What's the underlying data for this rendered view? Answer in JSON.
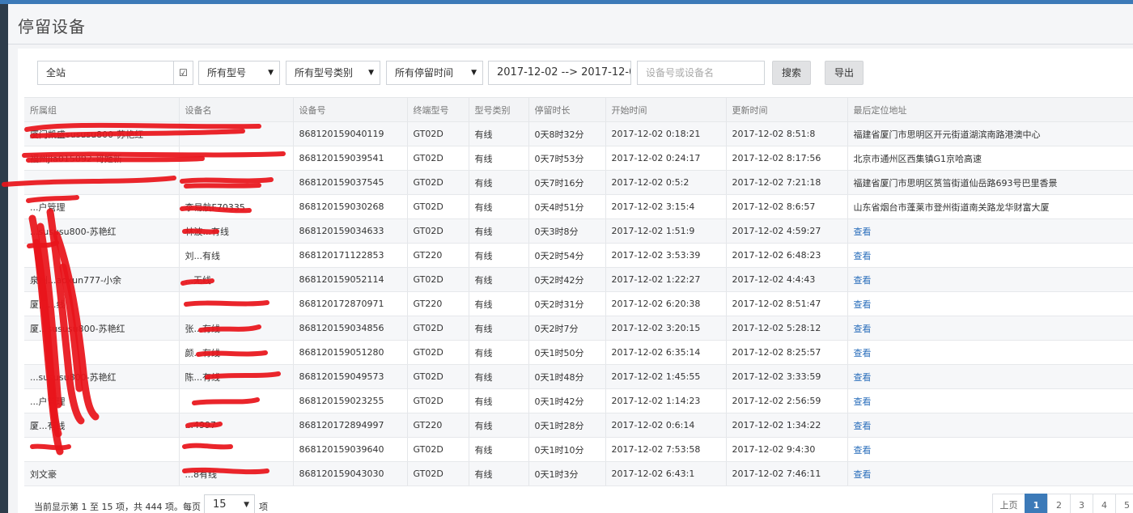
{
  "page": {
    "title": "停留设备"
  },
  "filters": {
    "scope": "全站",
    "model": "所有型号",
    "model_type": "所有型号类别",
    "stay_time": "所有停留时间",
    "date_range": "2017-12-02 --> 2017-12-0",
    "search_placeholder": "设备号或设备名",
    "search_label": "搜索",
    "export_label": "导出"
  },
  "table": {
    "columns": [
      "所属组",
      "设备名",
      "设备号",
      "终端型号",
      "型号类别",
      "停留时长",
      "开始时间",
      "更新时间",
      "最后定位地址"
    ],
    "rows": [
      [
        "厦门凯盛sususu800-苏艳红",
        "",
        "868120159040119",
        "GT02D",
        "有线",
        "0天8时32分",
        "2017-12-02 0:18:21",
        "2017-12-02 8:51:8",
        "福建省厦门市思明区开元街道湖滨南路港澳中心"
      ],
      [
        "福州jia015092-哥姬新",
        "",
        "868120159039541",
        "GT02D",
        "有线",
        "0天7时53分",
        "2017-12-02 0:24:17",
        "2017-12-02 8:17:56",
        "北京市通州区西集镇G1京哈高速"
      ],
      [
        "",
        "",
        "868120159037545",
        "GT02D",
        "有线",
        "0天7时16分",
        "2017-12-02 0:5:2",
        "2017-12-02 7:21:18",
        "福建省厦门市思明区筼筜街道仙岳路693号巴里香景"
      ],
      [
        "...户管理",
        "李易航F70335",
        "868120159030268",
        "GT02D",
        "有线",
        "0天4时51分",
        "2017-12-02 3:15:4",
        "2017-12-02 8:6:57",
        "山东省烟台市蓬莱市登州街道南关路龙华财富大厦"
      ],
      [
        "...sususu800-苏艳红",
        "林波...有线",
        "868120159034633",
        "GT02D",
        "有线",
        "0天3时8分",
        "2017-12-02 1:51:9",
        "2017-12-02 4:59:27",
        "查看"
      ],
      [
        "",
        "刘...有线",
        "868120171122853",
        "GT220",
        "有线",
        "0天2时54分",
        "2017-12-02 3:53:39",
        "2017-12-02 6:48:23",
        "查看"
      ],
      [
        "泉州...aoxun777-小余",
        "...无线",
        "868120159052114",
        "GT02D",
        "有线",
        "0天2时42分",
        "2017-12-02 1:22:27",
        "2017-12-02 4:4:43",
        "查看"
      ],
      [
        "厦门...线",
        "",
        "868120172870971",
        "GT220",
        "有线",
        "0天2时31分",
        "2017-12-02 6:20:38",
        "2017-12-02 8:51:47",
        "查看"
      ],
      [
        "厦...sususu800-苏艳红",
        "张...有线",
        "868120159034856",
        "GT02D",
        "有线",
        "0天2时7分",
        "2017-12-02 3:20:15",
        "2017-12-02 5:28:12",
        "查看"
      ],
      [
        "",
        "颜...有线",
        "868120159051280",
        "GT02D",
        "有线",
        "0天1时50分",
        "2017-12-02 6:35:14",
        "2017-12-02 8:25:57",
        "查看"
      ],
      [
        "...sususu800-苏艳红",
        "陈...有线",
        "868120159049573",
        "GT02D",
        "有线",
        "0天1时48分",
        "2017-12-02 1:45:55",
        "2017-12-02 3:33:59",
        "查看"
      ],
      [
        "...户管理",
        "",
        "868120159023255",
        "GT02D",
        "有线",
        "0天1时42分",
        "2017-12-02 1:14:23",
        "2017-12-02 2:56:59",
        "查看"
      ],
      [
        "厦...有线",
        "...4997",
        "868120172894997",
        "GT220",
        "有线",
        "0天1时28分",
        "2017-12-02 0:6:14",
        "2017-12-02 1:34:22",
        "查看"
      ],
      [
        "",
        "",
        "868120159039640",
        "GT02D",
        "有线",
        "0天1时10分",
        "2017-12-02 7:53:58",
        "2017-12-02 9:4:30",
        "查看"
      ],
      [
        "刘文豪",
        "...8有线",
        "868120159043030",
        "GT02D",
        "有线",
        "0天1时3分",
        "2017-12-02 6:43:1",
        "2017-12-02 7:46:11",
        "查看"
      ]
    ]
  },
  "footer": {
    "info": "当前显示第 1 至 15 项，共 444 项。每页",
    "per_page": "15",
    "per_page_suffix": "项",
    "pager": [
      "上页",
      "1",
      "2",
      "3",
      "4",
      "5"
    ]
  },
  "colors": {
    "accent": "#3c7ab8",
    "link": "#2a6ebb",
    "redaction": "#e8141b"
  }
}
